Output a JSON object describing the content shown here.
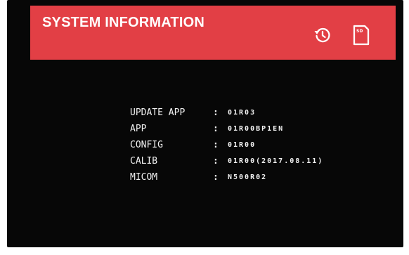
{
  "header": {
    "title": "SYSTEM INFORMATION",
    "background_color": "#e23f45",
    "icons": {
      "history": "history-icon",
      "sd_card": "sd-card-icon",
      "sd_label": "SD"
    }
  },
  "info": {
    "rows": [
      {
        "label": "UPDATE APP",
        "separator": ":",
        "value": "01R03"
      },
      {
        "label": "APP",
        "separator": ":",
        "value": "01R00BP1EN"
      },
      {
        "label": "CONFIG",
        "separator": ":",
        "value": "01R00"
      },
      {
        "label": "CALIB",
        "separator": ":",
        "value": "01R00(2017.08.11)"
      },
      {
        "label": "MICOM",
        "separator": ":",
        "value": "N500R02"
      }
    ]
  }
}
